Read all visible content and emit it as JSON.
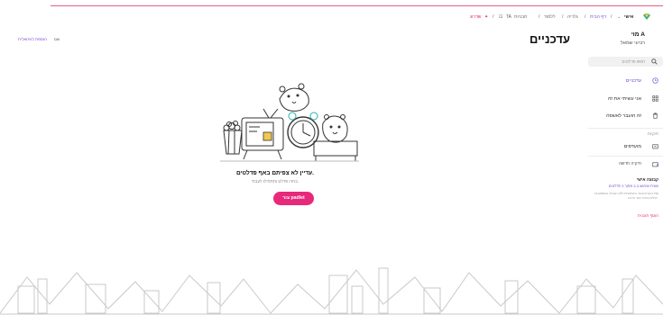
{
  "topbar": {
    "brand": "אישי",
    "crumb_library": "דף הבית",
    "crumb_gallery": "גלריה",
    "crumb_learn": "ללמוד",
    "crumb_templates": "תבניות",
    "crumb_ta": "TA",
    "crumb_upgrade": "שדרוג"
  },
  "sidebar": {
    "user_name": "מוי A",
    "user_sub": "רביעי שמאל",
    "search_placeholder": "חפש פדלטים",
    "items": [
      {
        "label": "עדכניים",
        "icon": "clock-icon"
      },
      {
        "label": "אני עשיתי את זה",
        "icon": "grid-icon"
      },
      {
        "label": "זה הועבר לאשפה",
        "icon": "trash-icon"
      }
    ],
    "section_label": "תיקיות",
    "favorites": "מועדפים",
    "new_folder": "תיקיה חדשה",
    "group_title": "קבוצה אישי",
    "group_sub": "עשית שימוש ב-3 מתוך 3 פדלטים",
    "group_desc": "שדרג אותו ועבוד בחופשיות ללא הגבלה ובמשאבים יעילים ביותר ועוד הרבה.",
    "upgrade_link": "הוסף תוכנית"
  },
  "main": {
    "title": "עדכניים",
    "empty_title": "עדיין לא צפיתם באף פדלטים.",
    "empty_sub": "בחרו פדלט ותתחילו לעבוד.",
    "button": "צור padlet",
    "lang_link": "הוספת לוויזואלית",
    "new_label": "שם"
  },
  "colors": {
    "accent": "#e8287a",
    "link": "#7b4fd6"
  }
}
